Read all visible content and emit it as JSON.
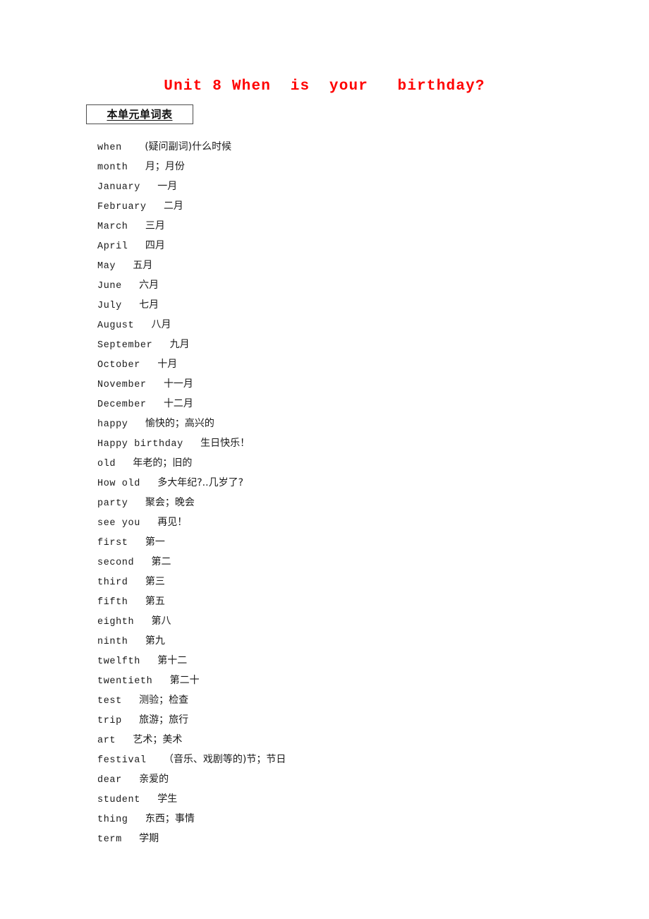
{
  "title": "Unit 8 When  is  your   birthday?",
  "section_heading": "本单元单词表",
  "words": [
    {
      "en": "when",
      "gap": "    ",
      "cn": "(疑问副词)什么时候"
    },
    {
      "en": "month",
      "gap": "   ",
      "cn": "月；月份"
    },
    {
      "en": "January",
      "gap": "   ",
      "cn": "一月"
    },
    {
      "en": "February",
      "gap": "   ",
      "cn": "二月"
    },
    {
      "en": "March",
      "gap": "   ",
      "cn": "三月"
    },
    {
      "en": "April",
      "gap": "   ",
      "cn": "四月"
    },
    {
      "en": "May",
      "gap": "   ",
      "cn": "五月"
    },
    {
      "en": "June",
      "gap": "   ",
      "cn": "六月"
    },
    {
      "en": "July",
      "gap": "   ",
      "cn": "七月"
    },
    {
      "en": "August",
      "gap": "   ",
      "cn": "八月"
    },
    {
      "en": "September",
      "gap": "   ",
      "cn": "九月"
    },
    {
      "en": "October",
      "gap": "   ",
      "cn": "十月"
    },
    {
      "en": "November",
      "gap": "   ",
      "cn": "十一月"
    },
    {
      "en": "December",
      "gap": "   ",
      "cn": "十二月"
    },
    {
      "en": "happy",
      "gap": "   ",
      "cn": "愉快的；高兴的"
    },
    {
      "en": "Happy birthday",
      "gap": "   ",
      "cn": "生日快乐！"
    },
    {
      "en": "old",
      "gap": "   ",
      "cn": "年老的；旧的"
    },
    {
      "en": "How old",
      "gap": "   ",
      "cn": "多大年纪?..几岁了?"
    },
    {
      "en": "party",
      "gap": "   ",
      "cn": "聚会；晚会"
    },
    {
      "en": "see you",
      "gap": "   ",
      "cn": "再见！"
    },
    {
      "en": "first",
      "gap": "   ",
      "cn": "第一"
    },
    {
      "en": "second",
      "gap": "   ",
      "cn": "第二"
    },
    {
      "en": "third",
      "gap": "   ",
      "cn": "第三"
    },
    {
      "en": "fifth",
      "gap": "   ",
      "cn": "第五"
    },
    {
      "en": "eighth",
      "gap": "   ",
      "cn": "第八"
    },
    {
      "en": "ninth",
      "gap": "   ",
      "cn": "第九"
    },
    {
      "en": "twelfth",
      "gap": "   ",
      "cn": "第十二"
    },
    {
      "en": "twentieth",
      "gap": "   ",
      "cn": "第二十"
    },
    {
      "en": "test",
      "gap": "   ",
      "cn": "测验；检查"
    },
    {
      "en": "trip",
      "gap": "   ",
      "cn": "旅游；旅行"
    },
    {
      "en": "art",
      "gap": "   ",
      "cn": "艺术；美术"
    },
    {
      "en": "festival",
      "gap": "   ",
      "cn": "（音乐、戏剧等的)节；节日"
    },
    {
      "en": "dear",
      "gap": "   ",
      "cn": "亲爱的"
    },
    {
      "en": "student",
      "gap": "   ",
      "cn": "学生"
    },
    {
      "en": "thing",
      "gap": "   ",
      "cn": "东西；事情"
    },
    {
      "en": "term",
      "gap": "   ",
      "cn": "学期"
    }
  ],
  "colors": {
    "title": "#ff0000",
    "text": "#1a1a1a",
    "box_border": "#4d4d4d",
    "background": "#ffffff"
  }
}
